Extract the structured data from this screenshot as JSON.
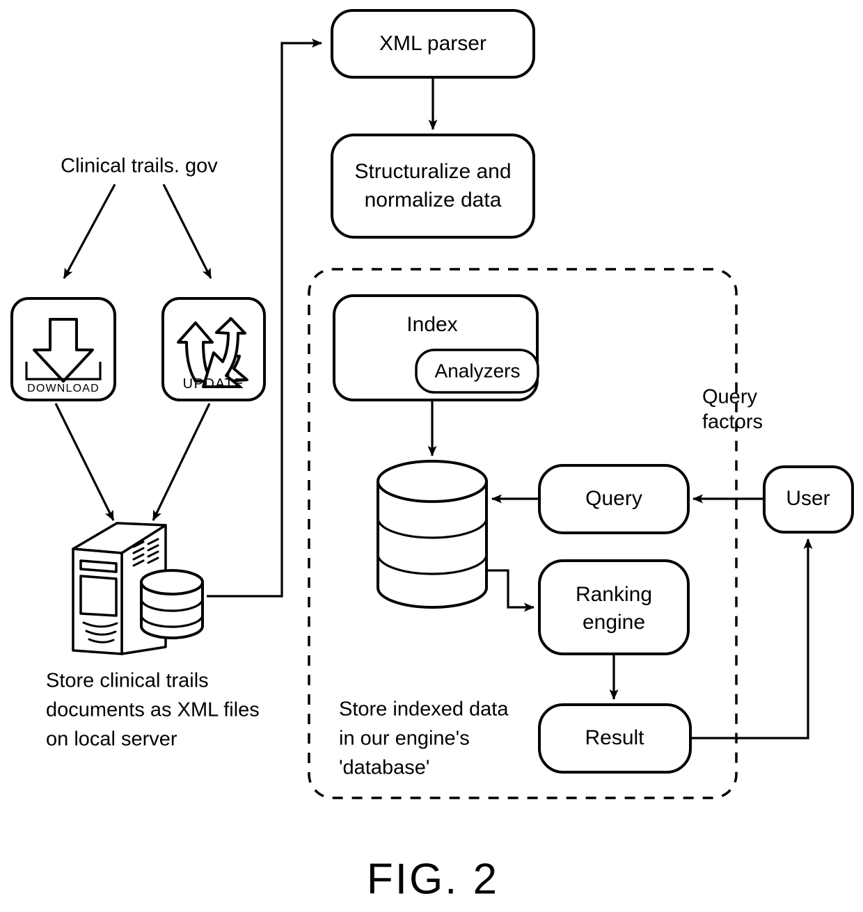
{
  "figure": {
    "caption": "FIG. 2"
  },
  "nodes": {
    "xml_parser": {
      "label": "XML parser"
    },
    "structuralize": {
      "line1": "Structuralize and",
      "line2": "normalize data"
    },
    "index": {
      "label": "Index"
    },
    "analyzers": {
      "label": "Analyzers"
    },
    "query": {
      "label": "Query"
    },
    "user": {
      "label": "User"
    },
    "ranking_engine": {
      "line1": "Ranking",
      "line2": "engine"
    },
    "result": {
      "label": "Result"
    }
  },
  "sources": {
    "clinical_trials": {
      "label": "Clinical trails. gov"
    },
    "download_icon": {
      "caption": "DOWNLOAD"
    },
    "update_icon": {
      "caption": "UPDATE"
    }
  },
  "annotations": {
    "query_factors": {
      "line1": "Query",
      "line2": "factors"
    },
    "store_local": {
      "line1": "Store clinical trails",
      "line2": "documents as XML files",
      "line3": "on local server"
    },
    "store_indexed": {
      "line1": "Store indexed data",
      "line2": "in our engine's",
      "line3": "'database'"
    }
  },
  "colors": {
    "stroke": "#000000",
    "fill": "#ffffff",
    "background": "#ffffff"
  }
}
